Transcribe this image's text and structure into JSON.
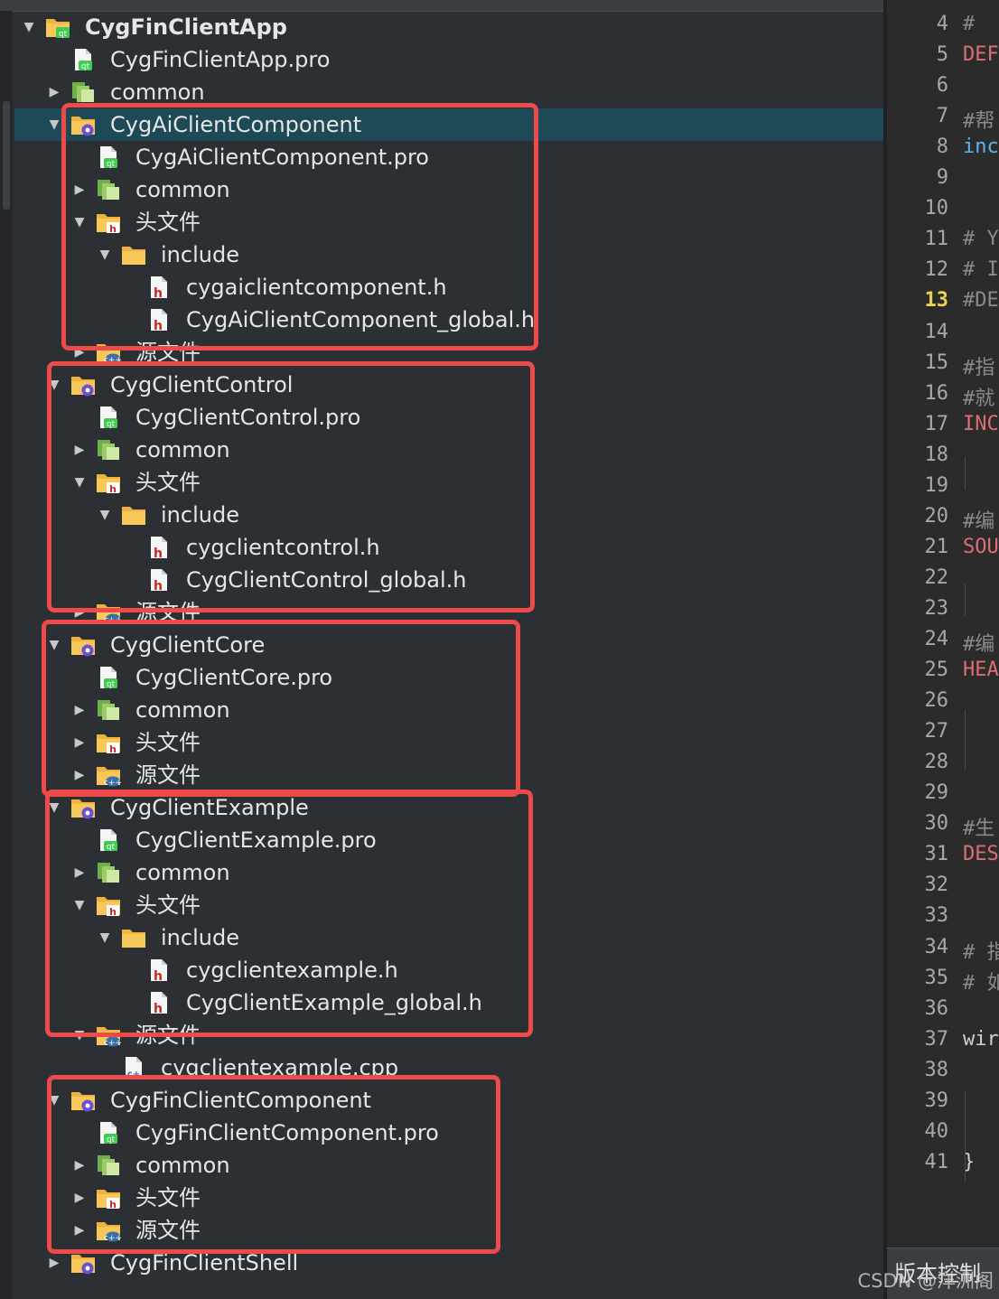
{
  "project_tree": {
    "rows": [
      {
        "label": "CygFinClientApp",
        "icon": "qt-project-folder-icon",
        "arrow": "expanded",
        "indent": 0,
        "bold": true
      },
      {
        "label": "CygFinClientApp.pro",
        "icon": "qt-pro-file-icon",
        "arrow": "none",
        "indent": 1
      },
      {
        "label": "common",
        "icon": "common-folder-icon",
        "arrow": "collapsed",
        "indent": 1
      },
      {
        "label": "CygAiClientComponent",
        "icon": "subproject-folder-icon",
        "arrow": "expanded",
        "indent": 1,
        "selected": true
      },
      {
        "label": "CygAiClientComponent.pro",
        "icon": "qt-pro-file-icon",
        "arrow": "none",
        "indent": 2
      },
      {
        "label": "common",
        "icon": "common-folder-icon",
        "arrow": "collapsed",
        "indent": 2
      },
      {
        "label": "头文件",
        "icon": "header-folder-icon",
        "arrow": "expanded",
        "indent": 2
      },
      {
        "label": "include",
        "icon": "folder-icon",
        "arrow": "expanded",
        "indent": 3
      },
      {
        "label": "cygaiclientcomponent.h",
        "icon": "header-file-icon",
        "arrow": "none",
        "indent": 4
      },
      {
        "label": "CygAiClientComponent_global.h",
        "icon": "header-file-icon",
        "arrow": "none",
        "indent": 4
      },
      {
        "label": "源文件",
        "icon": "source-folder-icon",
        "arrow": "collapsed",
        "indent": 2
      },
      {
        "label": "CygClientControl",
        "icon": "subproject-folder-icon",
        "arrow": "expanded",
        "indent": 1
      },
      {
        "label": "CygClientControl.pro",
        "icon": "qt-pro-file-icon",
        "arrow": "none",
        "indent": 2
      },
      {
        "label": "common",
        "icon": "common-folder-icon",
        "arrow": "collapsed",
        "indent": 2
      },
      {
        "label": "头文件",
        "icon": "header-folder-icon",
        "arrow": "expanded",
        "indent": 2
      },
      {
        "label": "include",
        "icon": "folder-icon",
        "arrow": "expanded",
        "indent": 3
      },
      {
        "label": "cygclientcontrol.h",
        "icon": "header-file-icon",
        "arrow": "none",
        "indent": 4
      },
      {
        "label": "CygClientControl_global.h",
        "icon": "header-file-icon",
        "arrow": "none",
        "indent": 4
      },
      {
        "label": "源文件",
        "icon": "source-folder-icon",
        "arrow": "collapsed",
        "indent": 2
      },
      {
        "label": "CygClientCore",
        "icon": "subproject-folder-icon",
        "arrow": "expanded",
        "indent": 1
      },
      {
        "label": "CygClientCore.pro",
        "icon": "qt-pro-file-icon",
        "arrow": "none",
        "indent": 2
      },
      {
        "label": "common",
        "icon": "common-folder-icon",
        "arrow": "collapsed",
        "indent": 2
      },
      {
        "label": "头文件",
        "icon": "header-folder-icon",
        "arrow": "collapsed",
        "indent": 2
      },
      {
        "label": "源文件",
        "icon": "source-folder-icon",
        "arrow": "collapsed",
        "indent": 2
      },
      {
        "label": "CygClientExample",
        "icon": "subproject-folder-icon",
        "arrow": "expanded",
        "indent": 1
      },
      {
        "label": "CygClientExample.pro",
        "icon": "qt-pro-file-icon",
        "arrow": "none",
        "indent": 2
      },
      {
        "label": "common",
        "icon": "common-folder-icon",
        "arrow": "collapsed",
        "indent": 2
      },
      {
        "label": "头文件",
        "icon": "header-folder-icon",
        "arrow": "expanded",
        "indent": 2
      },
      {
        "label": "include",
        "icon": "folder-icon",
        "arrow": "expanded",
        "indent": 3
      },
      {
        "label": "cygclientexample.h",
        "icon": "header-file-icon",
        "arrow": "none",
        "indent": 4
      },
      {
        "label": "CygClientExample_global.h",
        "icon": "header-file-icon",
        "arrow": "none",
        "indent": 4
      },
      {
        "label": "源文件",
        "icon": "source-folder-icon",
        "arrow": "expanded",
        "indent": 2
      },
      {
        "label": "cygclientexample.cpp",
        "icon": "cpp-file-icon",
        "arrow": "none",
        "indent": 3
      },
      {
        "label": "CygFinClientComponent",
        "icon": "subproject-folder-icon",
        "arrow": "expanded",
        "indent": 1
      },
      {
        "label": "CygFinClientComponent.pro",
        "icon": "qt-pro-file-icon",
        "arrow": "none",
        "indent": 2
      },
      {
        "label": "common",
        "icon": "common-folder-icon",
        "arrow": "collapsed",
        "indent": 2
      },
      {
        "label": "头文件",
        "icon": "header-folder-icon",
        "arrow": "collapsed",
        "indent": 2
      },
      {
        "label": "源文件",
        "icon": "source-folder-icon",
        "arrow": "collapsed",
        "indent": 2
      },
      {
        "label": "CygFinClientShell",
        "icon": "subproject-folder-icon",
        "arrow": "collapsed",
        "indent": 1
      }
    ]
  },
  "editor": {
    "current_line": "13",
    "lines": [
      {
        "n": "4",
        "t": "# ",
        "c": "#8a8a8a"
      },
      {
        "n": "5",
        "t": "DEF",
        "c": "#e06c75"
      },
      {
        "n": "6",
        "t": "",
        "c": "#8a8a8a"
      },
      {
        "n": "7",
        "t": "#帮",
        "c": "#8a8a8a"
      },
      {
        "n": "8",
        "t": "inc",
        "c": "#5fb4e8"
      },
      {
        "n": "9",
        "t": "",
        "c": "#8a8a8a"
      },
      {
        "n": "10",
        "t": "",
        "c": "#8a8a8a"
      },
      {
        "n": "11",
        "t": "# Y",
        "c": "#8a8a8a"
      },
      {
        "n": "12",
        "t": "# I",
        "c": "#8a8a8a"
      },
      {
        "n": "13",
        "t": "#DE",
        "c": "#8a8a8a"
      },
      {
        "n": "14",
        "t": "",
        "c": "#8a8a8a"
      },
      {
        "n": "15",
        "t": "#指",
        "c": "#8a8a8a"
      },
      {
        "n": "16",
        "t": "#就",
        "c": "#8a8a8a"
      },
      {
        "n": "17",
        "t": "INC",
        "c": "#e06c75"
      },
      {
        "n": "18",
        "t": "",
        "c": "#8a8a8a"
      },
      {
        "n": "19",
        "t": "",
        "c": "#8a8a8a"
      },
      {
        "n": "20",
        "t": "#编",
        "c": "#8a8a8a"
      },
      {
        "n": "21",
        "t": "SOU",
        "c": "#e06c75"
      },
      {
        "n": "22",
        "t": "",
        "c": "#8a8a8a"
      },
      {
        "n": "23",
        "t": "",
        "c": "#8a8a8a"
      },
      {
        "n": "24",
        "t": "#编",
        "c": "#8a8a8a"
      },
      {
        "n": "25",
        "t": "HEA",
        "c": "#e06c75"
      },
      {
        "n": "26",
        "t": "",
        "c": "#8a8a8a"
      },
      {
        "n": "27",
        "t": "",
        "c": "#8a8a8a"
      },
      {
        "n": "28",
        "t": "",
        "c": "#8a8a8a"
      },
      {
        "n": "29",
        "t": "",
        "c": "#8a8a8a"
      },
      {
        "n": "30",
        "t": "#生",
        "c": "#8a8a8a"
      },
      {
        "n": "31",
        "t": "DES",
        "c": "#e06c75"
      },
      {
        "n": "32",
        "t": "",
        "c": "#8a8a8a"
      },
      {
        "n": "33",
        "t": "",
        "c": "#8a8a8a"
      },
      {
        "n": "34",
        "t": "# 指",
        "c": "#8a8a8a"
      },
      {
        "n": "35",
        "t": "# 如",
        "c": "#8a8a8a"
      },
      {
        "n": "36",
        "t": "",
        "c": "#8a8a8a"
      },
      {
        "n": "37",
        "t": "wir",
        "c": "#d0d0d0"
      },
      {
        "n": "38",
        "t": "",
        "c": "#8a8a8a"
      },
      {
        "n": "39",
        "t": "",
        "c": "#8a8a8a"
      },
      {
        "n": "40",
        "t": "",
        "c": "#8a8a8a"
      },
      {
        "n": "41",
        "t": "}",
        "c": "#d0d0d0"
      }
    ]
  },
  "bottom_panel": {
    "version_control_label": "版本控制"
  },
  "watermark": "CSDN @洋洲阁",
  "colors": {
    "highlight_box": "#ef4a4a",
    "selection": "#1d4a56",
    "current_line": "#e8d44d"
  }
}
